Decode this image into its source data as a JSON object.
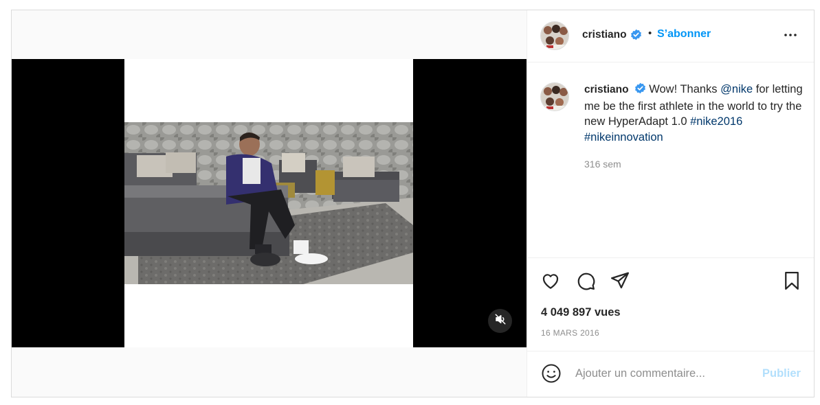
{
  "post": {
    "username": "cristiano",
    "follow_label": "S’abonner",
    "separator": "•",
    "more_icon": "more-horizontal-icon"
  },
  "caption": {
    "username": "cristiano",
    "text_before": "Wow! Thanks",
    "mention": "@nike",
    "text_after": "for letting me be the first athlete in the world to try the new HyperAdapt 1.0",
    "hashtag_1": "#nike2016",
    "hashtag_2": "#nikeinnovation",
    "time": "316 sem"
  },
  "stats": {
    "views": "4 049 897 vues",
    "date": "16 MARS 2016"
  },
  "comment": {
    "placeholder": "Ajouter un commentaire...",
    "publish_label": "Publier"
  },
  "icons": {
    "like": "heart-icon",
    "comment": "comment-icon",
    "share": "send-icon",
    "save": "bookmark-icon",
    "emoji": "emoji-icon",
    "mute": "volume-muted-icon",
    "verified": "verified-badge-icon"
  },
  "colors": {
    "accent": "#0095f6",
    "link": "#00376b",
    "muted_text": "#8e8e8e",
    "publish_disabled": "#b2dffc",
    "verified": "#3897f0"
  }
}
